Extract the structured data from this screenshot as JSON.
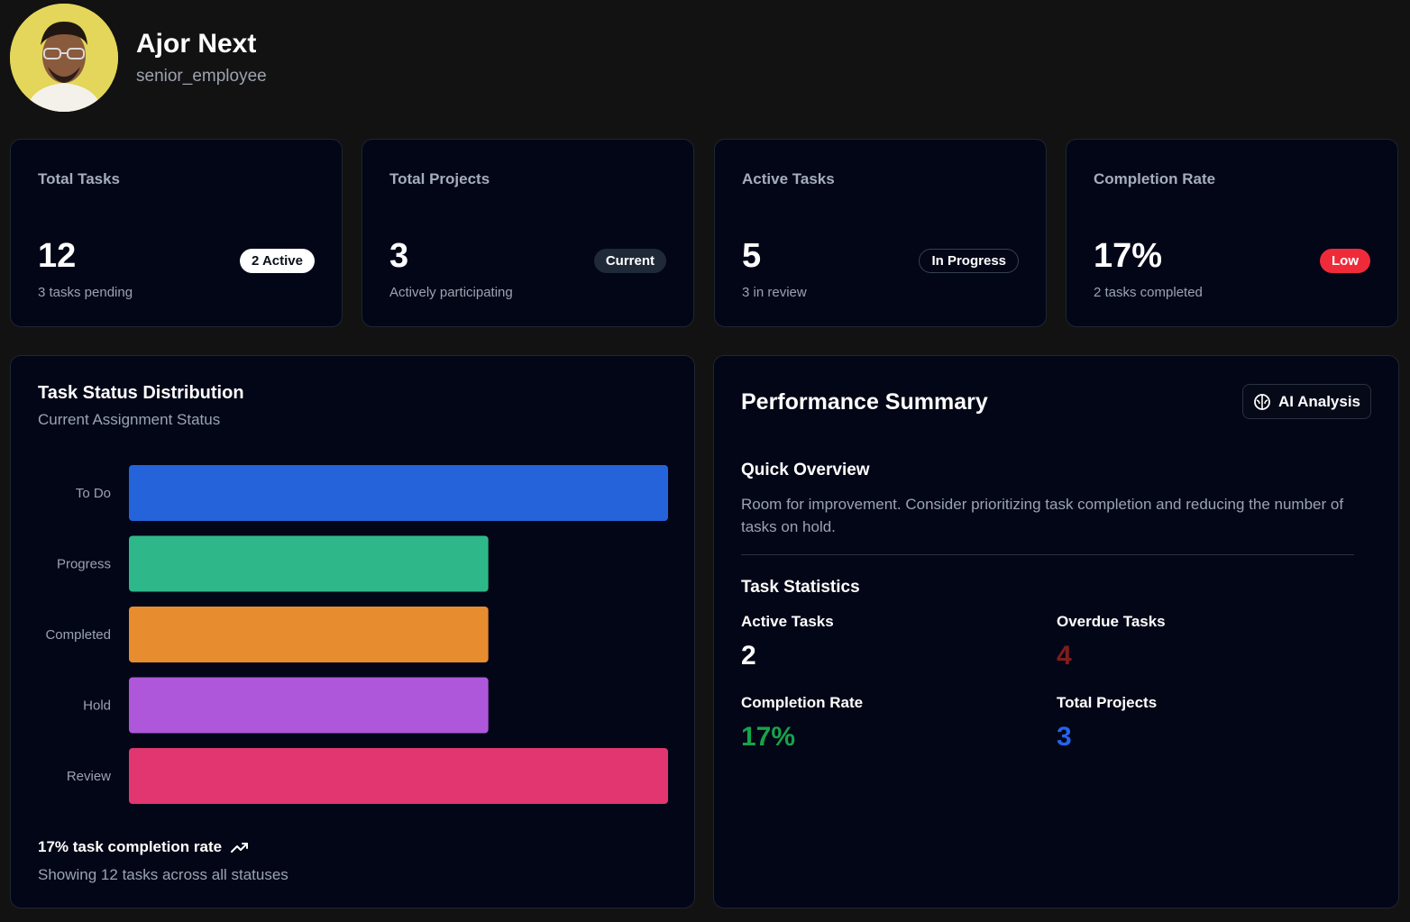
{
  "profile": {
    "name": "Ajor Next",
    "role": "senior_employee"
  },
  "stats": [
    {
      "title": "Total Tasks",
      "value": "12",
      "badge": "2 Active",
      "sub": "3 tasks pending"
    },
    {
      "title": "Total Projects",
      "value": "3",
      "badge": "Current",
      "sub": "Actively participating"
    },
    {
      "title": "Active Tasks",
      "value": "5",
      "badge": "In Progress",
      "sub": "3 in review"
    },
    {
      "title": "Completion Rate",
      "value": "17%",
      "badge": "Low",
      "sub": "2 tasks completed"
    }
  ],
  "distribution": {
    "title": "Task Status Distribution",
    "subtitle": "Current Assignment Status",
    "footer_rate": "17% task completion rate",
    "footer_note": "Showing 12 tasks across all statuses"
  },
  "chart_data": {
    "type": "bar",
    "orientation": "horizontal",
    "categories": [
      "To Do",
      "Progress",
      "Completed",
      "Hold",
      "Review"
    ],
    "values": [
      3,
      2,
      2,
      2,
      3
    ],
    "xlim": [
      0,
      3
    ],
    "grid": false,
    "colors": [
      "#2563db",
      "#2eb88a",
      "#e88c30",
      "#af57db",
      "#e23670"
    ]
  },
  "performance": {
    "title": "Performance Summary",
    "ai_button": "AI Analysis",
    "overview_title": "Quick Overview",
    "overview_text": "Room for improvement. Consider prioritizing task completion and reducing the number of tasks on hold.",
    "stats_title": "Task Statistics",
    "stats": [
      {
        "label": "Active Tasks",
        "value": "2",
        "color": "#ffffff"
      },
      {
        "label": "Overdue Tasks",
        "value": "4",
        "color": "#7f1d1d"
      },
      {
        "label": "Completion Rate",
        "value": "17%",
        "color": "#16a34a"
      },
      {
        "label": "Total Projects",
        "value": "3",
        "color": "#2563eb"
      }
    ]
  }
}
